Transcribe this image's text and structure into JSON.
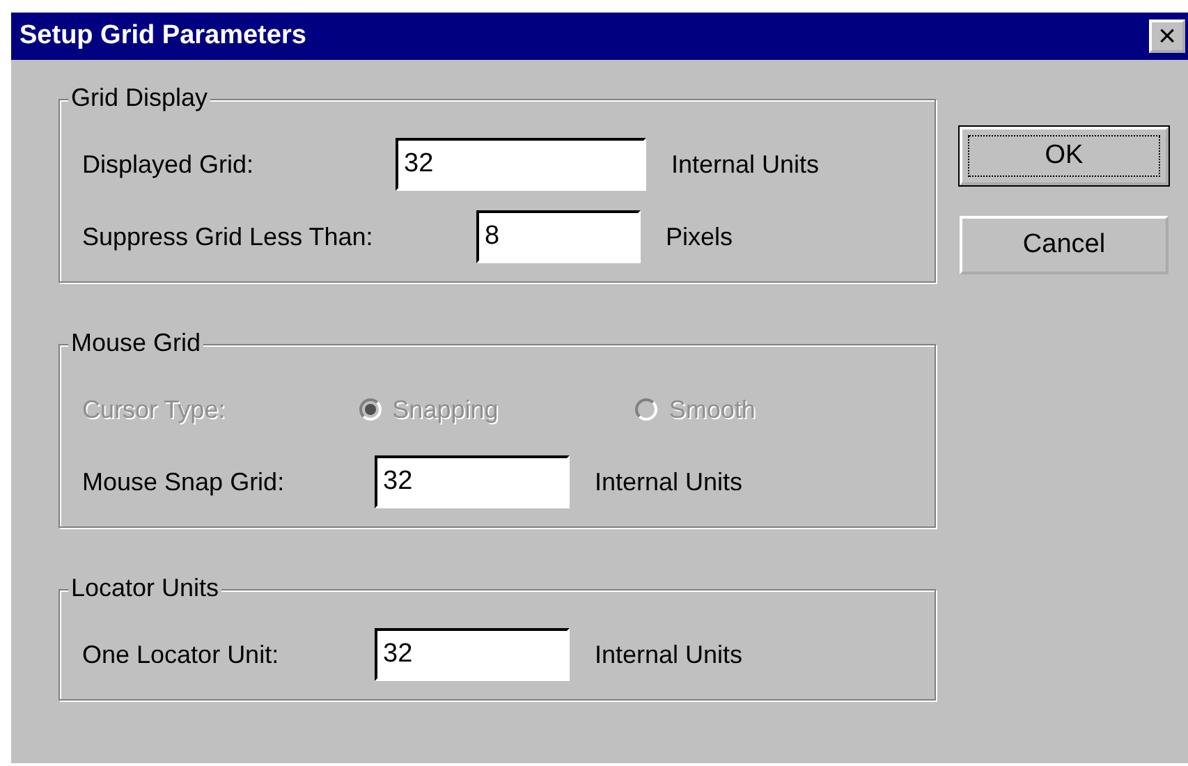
{
  "window": {
    "title": "Setup Grid Parameters",
    "close": "×"
  },
  "groups": [
    {
      "title": "Grid Display",
      "rows": [
        {
          "kind": "field",
          "label": "Displayed Grid:",
          "value": "32",
          "unit": "Internal Units"
        },
        {
          "kind": "field",
          "label": "Suppress Grid Less Than:",
          "value": "8",
          "unit": "Pixels"
        }
      ]
    },
    {
      "title": "Mouse Grid",
      "rows": [
        {
          "kind": "radio",
          "label": "Cursor Type:",
          "disabled": true,
          "options": [
            {
              "label": "Snapping",
              "selected": true
            },
            {
              "label": "Smooth",
              "selected": false
            }
          ]
        },
        {
          "kind": "field",
          "label": "Mouse Snap Grid:",
          "value": "32",
          "unit": "Internal Units"
        }
      ]
    },
    {
      "title": "Locator Units",
      "rows": [
        {
          "kind": "field",
          "label": "One Locator Unit:",
          "value": "32",
          "unit": "Internal Units"
        }
      ]
    }
  ],
  "buttons": [
    {
      "label": "OK",
      "default": true
    },
    {
      "label": "Cancel",
      "default": false
    }
  ]
}
